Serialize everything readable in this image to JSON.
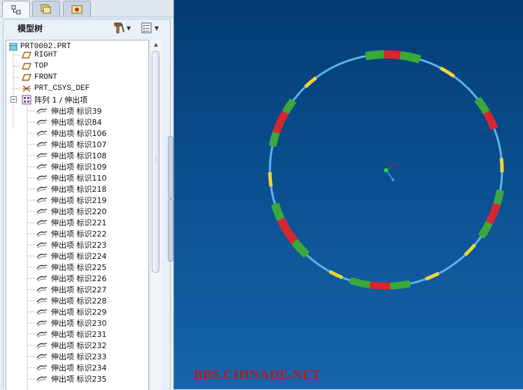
{
  "tabs": [
    {
      "name": "model-tree-tab",
      "icon": "model-tree-icon"
    },
    {
      "name": "folder-browser-tab",
      "icon": "folders-icon"
    },
    {
      "name": "favorites-tab",
      "icon": "favorites-icon"
    }
  ],
  "panel": {
    "title": "模型树",
    "settings_icon": "tools-icon",
    "show_icon": "list-icon"
  },
  "tree": {
    "root": "PRT0002.PRT",
    "datums": [
      {
        "label": "RIGHT",
        "icon": "datum-plane-icon"
      },
      {
        "label": "TOP",
        "icon": "datum-plane-icon"
      },
      {
        "label": "FRONT",
        "icon": "datum-plane-icon"
      },
      {
        "label": "PRT_CSYS_DEF",
        "icon": "csys-icon"
      }
    ],
    "pattern": {
      "label": "阵列 1 / 伸出项",
      "expanded": true
    },
    "items": [
      "伸出项 标识39",
      "伸出项 标识84",
      "伸出项 标识106",
      "伸出项 标识107",
      "伸出项 标识108",
      "伸出项 标识109",
      "伸出项 标识110",
      "伸出项 标识218",
      "伸出项 标识219",
      "伸出项 标识220",
      "伸出项 标识221",
      "伸出项 标识222",
      "伸出项 标识223",
      "伸出项 标识224",
      "伸出项 标识225",
      "伸出项 标识226",
      "伸出项 标识227",
      "伸出项 标识228",
      "伸出项 标识229",
      "伸出项 标识230",
      "伸出项 标识231",
      "伸出项 标识232",
      "伸出项 标识233",
      "伸出项 标识234",
      "伸出项 标识235"
    ]
  },
  "viewport": {
    "background_top": "#043c74",
    "background_bottom": "#1665ab",
    "ring_color": "#5ab4e8",
    "segment_colors": {
      "green": "#3aa83a",
      "red": "#d8262e",
      "yellow": "#f0d43a"
    },
    "csys_colors": {
      "x": "#e02020",
      "y": "#20e020",
      "z": "#40a0ff"
    }
  },
  "watermark": "BBS.CHINADE.NET"
}
